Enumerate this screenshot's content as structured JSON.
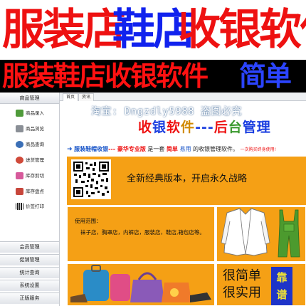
{
  "banner": {
    "line1_part1": "服装店",
    "line1_part2": "鞋店",
    "line1_part3": "收银软件",
    "line2_part1": "服装鞋店收银软件",
    "line2_part2": "简单"
  },
  "sidebar": {
    "header": "商品管理",
    "items": [
      {
        "label": "商品录入",
        "icon": "product-entry-icon",
        "color": "#4f9a3a"
      },
      {
        "label": "商品浏览",
        "icon": "product-browse-icon",
        "color": "#8a8f96"
      },
      {
        "label": "商品查询",
        "icon": "product-search-icon",
        "color": "#3b6fb6"
      },
      {
        "label": "进货管理",
        "icon": "purchase-icon",
        "color": "#d04a3a"
      },
      {
        "label": "库存剪切",
        "icon": "stock-cut-icon",
        "color": "#d65a9b"
      },
      {
        "label": "库存盘点",
        "icon": "stock-check-icon",
        "color": "#c7463b"
      },
      {
        "label": "价签打印",
        "icon": "barcode-icon",
        "color": "#222222"
      }
    ],
    "groups": [
      "会员管理",
      "促销管理",
      "统计查询",
      "系统设置",
      "正版服务"
    ]
  },
  "tabs": [
    "首页",
    "资讯"
  ],
  "content": {
    "back_title": [
      "收",
      "银",
      "软",
      "件",
      "---",
      "后",
      "台",
      "管",
      "理"
    ],
    "back_title_colors": [
      "#e11",
      "#1a3ee0",
      "#e11",
      "#d18a00",
      "#1a3ee0",
      "#e11",
      "#3b9a2f",
      "#1a3ee0",
      "#1a3ee0"
    ],
    "desc_arrow": "➜",
    "desc_product": "服装鞋帽收银",
    "desc_edition": "--- 豪华专业版",
    "desc_is": " 是一套 ",
    "desc_simple": "简单",
    "desc_easy": " 易用",
    "desc_rest": " 的收银管理软件。",
    "desc_note": "一次购买终身使用!",
    "slogan": "全新经典版本，开启永久战略",
    "taobao": "淘宝: Dngzdly5988 盗图必究",
    "usage_label": "使用范围：",
    "usage_value": "袜子店，胸罩店，内裤店，服装店，鞋店,箱包店等。",
    "simple1": "很简单",
    "simple2": "很实用",
    "kaopu1": "靠",
    "kaopu2": "谱"
  }
}
